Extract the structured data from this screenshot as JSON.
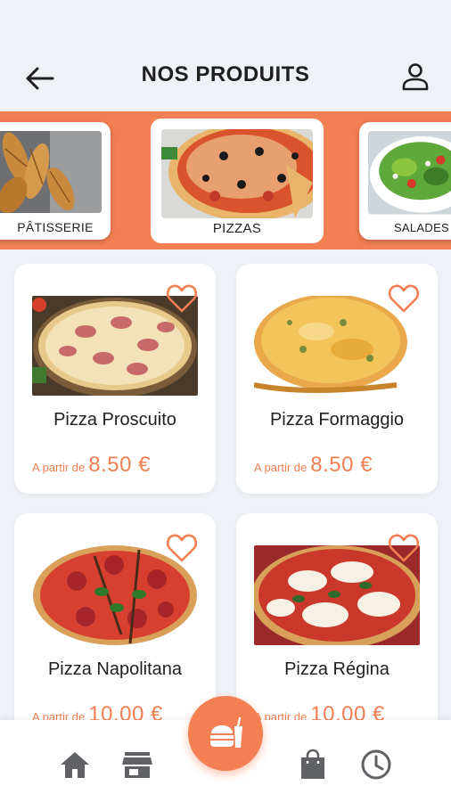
{
  "header": {
    "title": "NOS PRODUITS",
    "back_icon": "arrow-left-icon",
    "user_icon": "user-icon"
  },
  "categories": [
    {
      "label": "PÂTISSERIE",
      "image": "pastry-photo",
      "selected": false
    },
    {
      "label": "PIZZAS",
      "image": "pizza-photo",
      "selected": true
    },
    {
      "label": "SALADES",
      "image": "salad-photo",
      "selected": false
    }
  ],
  "products": [
    {
      "name": "Pizza Proscuito",
      "price_prefix": "A partir de",
      "price": "8.50 €",
      "image": "pizza-prosciutto-photo"
    },
    {
      "name": "Pizza Formaggio",
      "price_prefix": "A partir de",
      "price": "8.50 €",
      "image": "pizza-formaggio-photo"
    },
    {
      "name": "Pizza Napolitana",
      "price_prefix": "A partir de",
      "price": "10.00 €",
      "image": "pizza-napolitana-photo"
    },
    {
      "name": "Pizza Régina",
      "price_prefix": "A partir de",
      "price": "10.00 €",
      "image": "pizza-regina-photo"
    }
  ],
  "nav": {
    "items": [
      "home-icon",
      "store-icon",
      "food-icon",
      "shopping-bag-icon",
      "clock-icon"
    ]
  },
  "colors": {
    "accent": "#f47f52",
    "background": "#eef1f6",
    "icon": "#5f6165"
  }
}
